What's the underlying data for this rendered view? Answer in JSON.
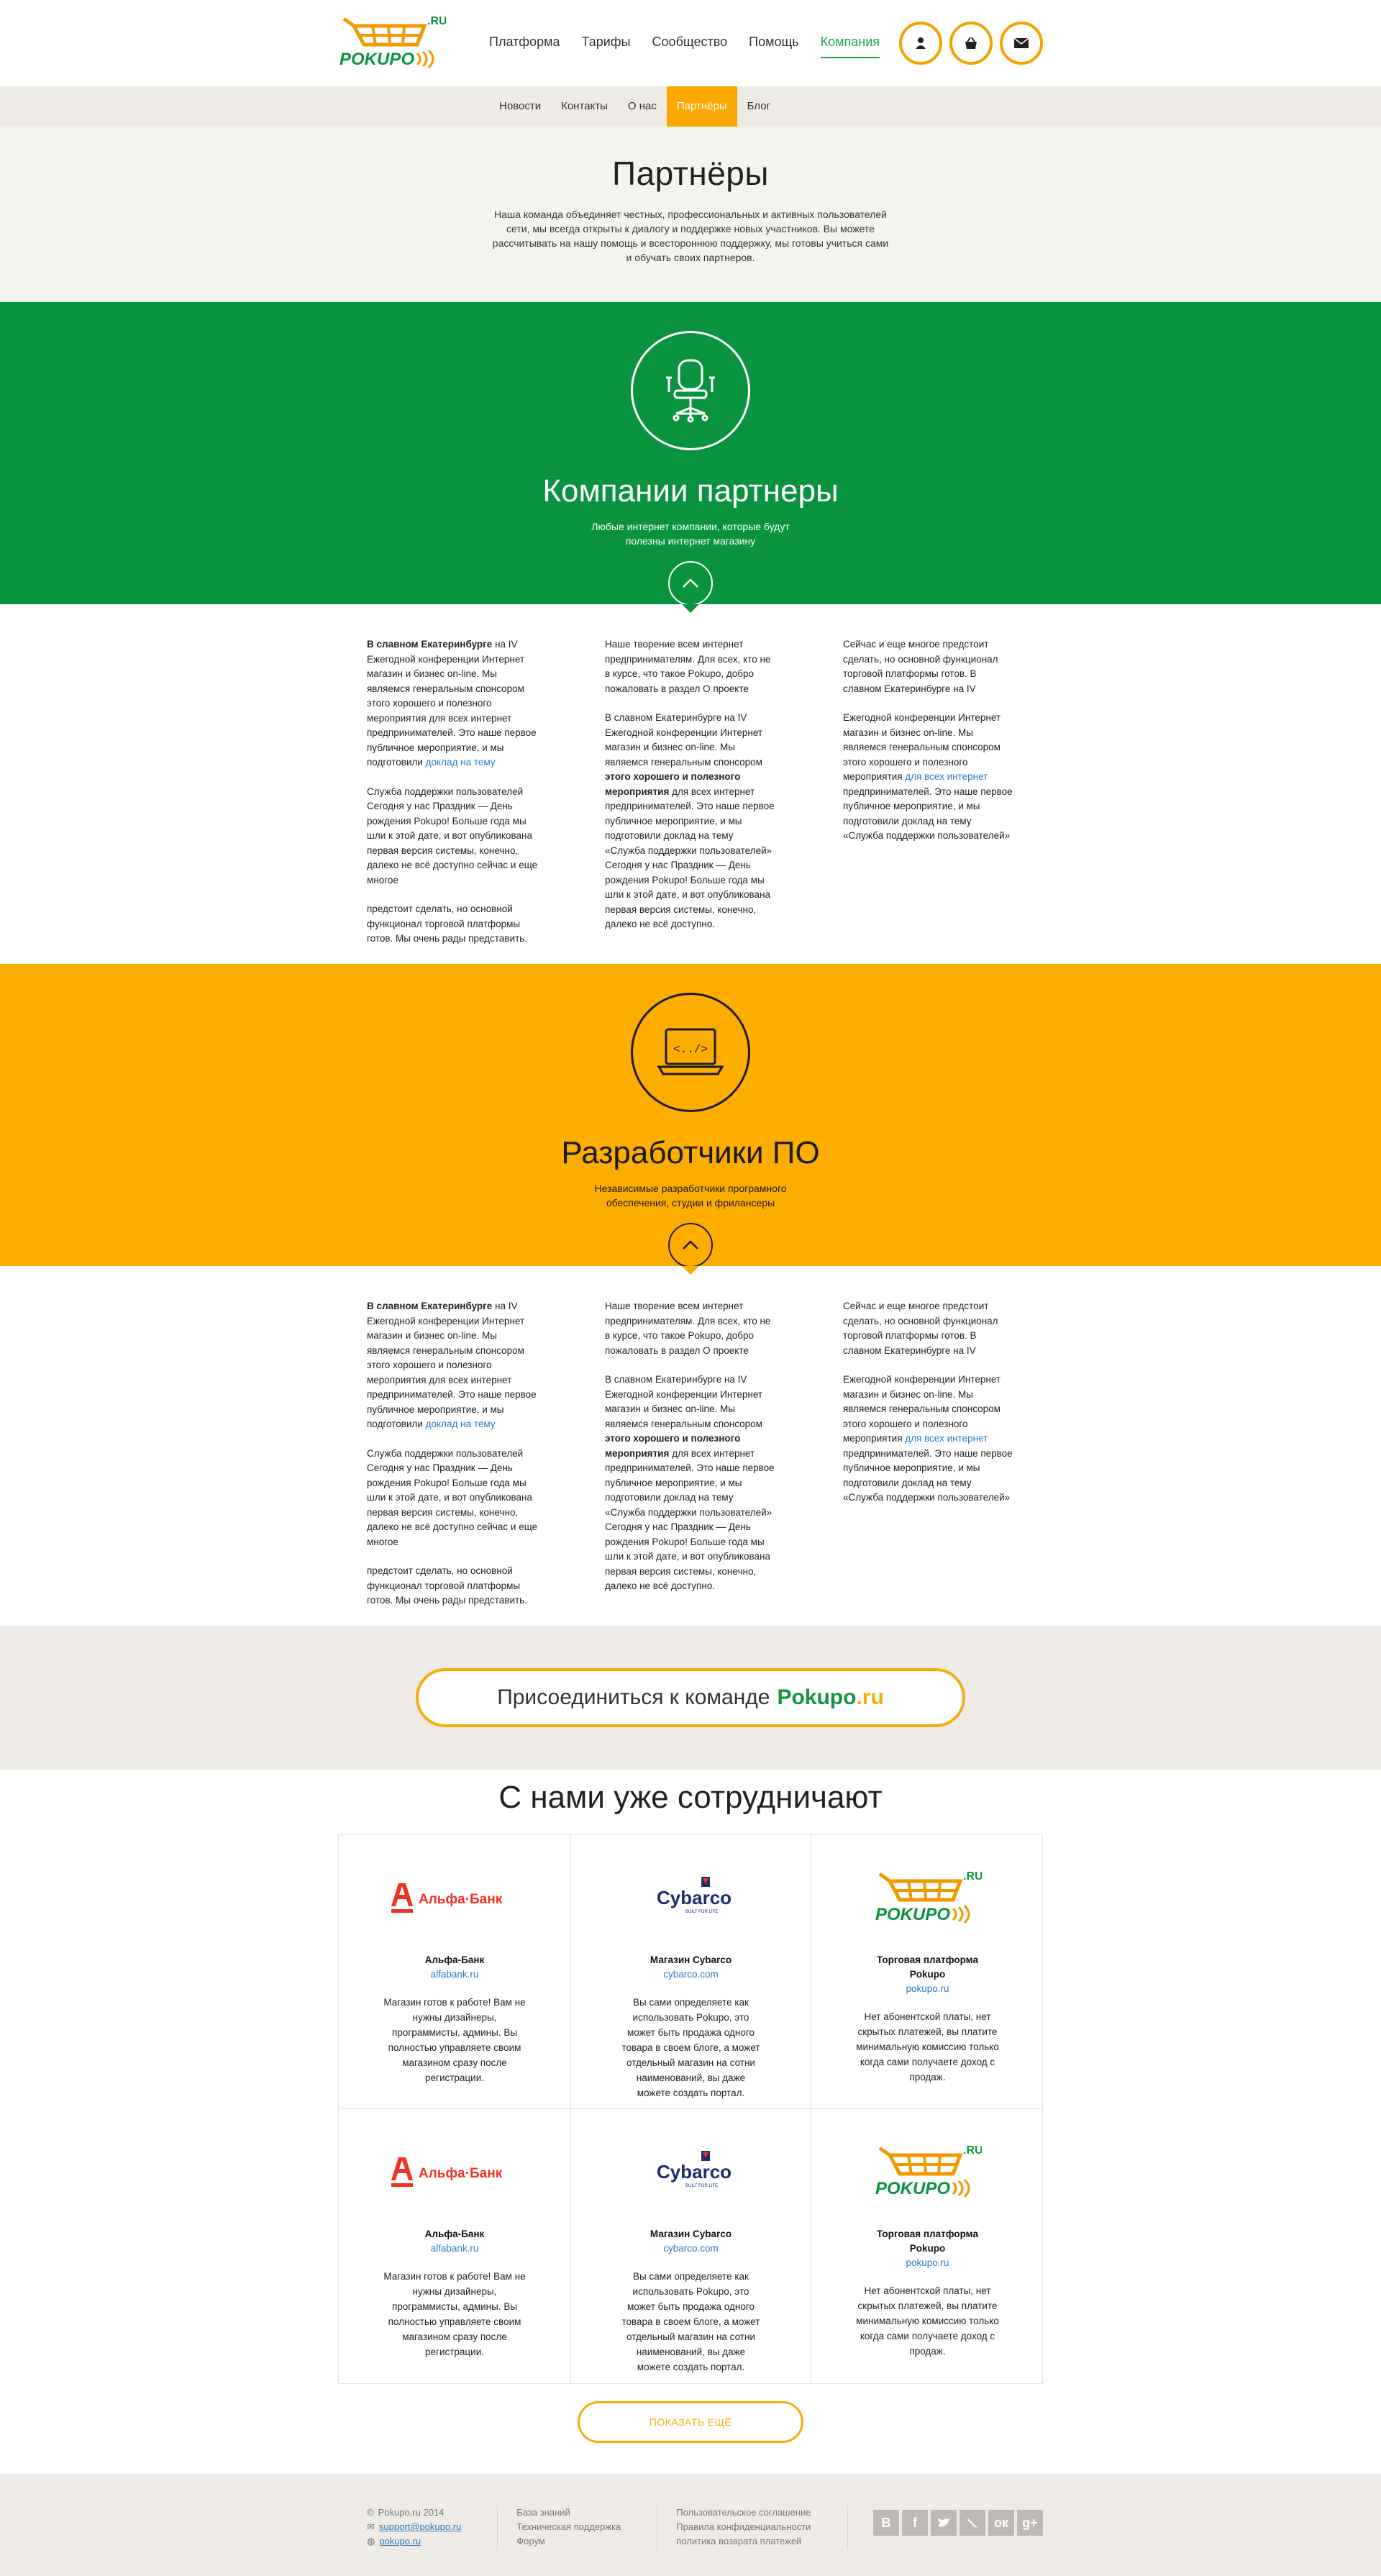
{
  "header": {
    "nav": [
      "Платформа",
      "Тарифы",
      "Сообщество",
      "Помощь",
      "Компания"
    ],
    "active_nav": "Компания"
  },
  "subnav": [
    "Новости",
    "Контакты",
    "О нас",
    "Партнёры",
    "Блог"
  ],
  "intro": {
    "title": "Партнёры",
    "text": "Наша команда объединяет честных, профессиональных и активных пользователей сети, мы всегда открыты к диалогу и поддержке новых участников. Вы можете рассчитывать на нашу помощь и всестороннюю поддержку, мы готовы учиться сами и обучать своих партнеров."
  },
  "section1": {
    "title": "Компании партнеры",
    "subtitle": "Любые интернет компании, которые будут полезны интернет магазину",
    "icon": "office-chair-icon"
  },
  "section2": {
    "title": "Разработчики ПО",
    "subtitle": "Независимые разработчики програмного обеспечения, студии и фрилансеры",
    "icon": "code-laptop-icon",
    "code_glyph": "<../>"
  },
  "text": {
    "c1_bold": "В славном Екатеринбурге",
    "c1_p1": " на IV Ежегодной конференции Интернет магазин и бизнес on-line. Мы являемся генеральным спонсором этого хорошего и полезного мероприятия для всех интернет предпринимателей. Это наше первое публичное мероприятие, и мы подготовили ",
    "c1_link": "доклад на тему",
    "c1_p2": "Служба поддержки пользователей Сегодня у нас Праздник — День рождения Pokupo! Больше года мы шли к этой дате, и вот опубликована первая версия системы, конечно, далеко не всё доступно сейчас и еще многое",
    "c1_p3": "предстоит сделать, но основной функционал торговой платформы готов. Мы очень рады представить.",
    "c2_p1": "Наше творение всем интернет предпринимателям. Для всех, кто не в курсе, что такое Pokupo, добро пожаловать в раздел О проекте",
    "c2_p2a": "В славном Екатеринбурге на IV Ежегодной конференции Интернет магазин и бизнес on-line. Мы являемся генеральным спонсором ",
    "c2_bold": "этого хорошего и полезного мероприятия",
    "c2_p2b": " для всех интернет предпринимателей. Это наше первое публичное мероприятие, и мы подготовили доклад на тему «Служба поддержки пользователей» Сегодня у нас Праздник — День рождения Pokupo! Больше года мы шли к этой дате, и вот опубликована первая версия системы, конечно, далеко не всё доступно.",
    "c3_p1": "Сейчас и еще многое предстоит сделать, но основной функционал торговой платформы готов. В славном Екатеринбурге на IV",
    "c3_p2a": "Ежегодной конференции Интернет магазин и бизнес on-line. Мы являемся генеральным спонсором этого хорошего и полезного мероприятия ",
    "c3_link": "для всех интернет",
    "c3_p2b": " предпринимателей. Это наше первое публичное мероприятие, и мы подготовили доклад на тему «Служба поддержки пользователей»"
  },
  "join": {
    "text": "Присоединиться к команде",
    "brand": "Pokupo",
    "brand_suffix": ".ru"
  },
  "partners": {
    "title": "С нами уже сотрудничают",
    "items": [
      {
        "name": "Альфа-Банк",
        "url": "alfabank.ru",
        "desc": "Магазин готов к работе! Вам не нужны дизайнеры, программисты, админы. Вы полностью управляете своим магазином сразу после регистрации.",
        "logo_text": "Альфа·Банк"
      },
      {
        "name": "Магазин Cybarco",
        "url": "cybarco.com",
        "desc": "Вы сами определяете как использовать Pokupo, это может быть продажа одного товара в своем блоге, а может отдельный магазин на сотни наименований, вы даже можете создать портал.",
        "logo_text": "Cybarco",
        "logo_sub": "BUILT FOR LIFE"
      },
      {
        "name": "Торговая платформа Pokupo",
        "url": "pokupo.ru",
        "desc": "Нет абонентской платы, нет скрытых платежей, вы платите минимальную комиссию только когда сами получаете доход с продаж.",
        "logo_text": "POKUPO",
        "logo_sub": ".RU"
      },
      {
        "name": "Альфа-Банк",
        "url": "alfabank.ru",
        "desc": "Магазин готов к работе! Вам не нужны дизайнеры, программисты, админы. Вы полностью управляете своим магазином сразу после регистрации.",
        "logo_text": "Альфа·Банк"
      },
      {
        "name": "Магазин Cybarco",
        "url": "cybarco.com",
        "desc": "Вы сами определяете как использовать Pokupo, это может быть продажа одного товара в своем блоге, а может отдельный магазин на сотни наименований, вы даже можете создать портал.",
        "logo_text": "Cybarco",
        "logo_sub": "BUILT FOR LIFE"
      },
      {
        "name": "Торговая платформа Pokupo",
        "url": "pokupo.ru",
        "desc": "Нет абонентской платы, нет скрытых платежей, вы платите минимальную комиссию только когда сами получаете доход с продаж.",
        "logo_text": "POKUPO",
        "logo_sub": ".RU"
      }
    ],
    "more": "ПОКАЗАТЬ ЕЩЁ"
  },
  "footer": {
    "copyright": "Pokupo.ru 2014",
    "email": "support@pokupo.ru",
    "site": "pokupo.ru",
    "links1": [
      "База знаний",
      "Техническая поддержка",
      "Форум"
    ],
    "links2": [
      "Пользовательское соглашение",
      "Правила конфиденциальности",
      "политика возврата платежей"
    ],
    "social": [
      "В",
      "f",
      "twitter",
      "livejournal",
      "ок",
      "g+"
    ]
  },
  "colors": {
    "green": "#0a933f",
    "orange": "#fdac00",
    "link": "#2a7bc0"
  }
}
